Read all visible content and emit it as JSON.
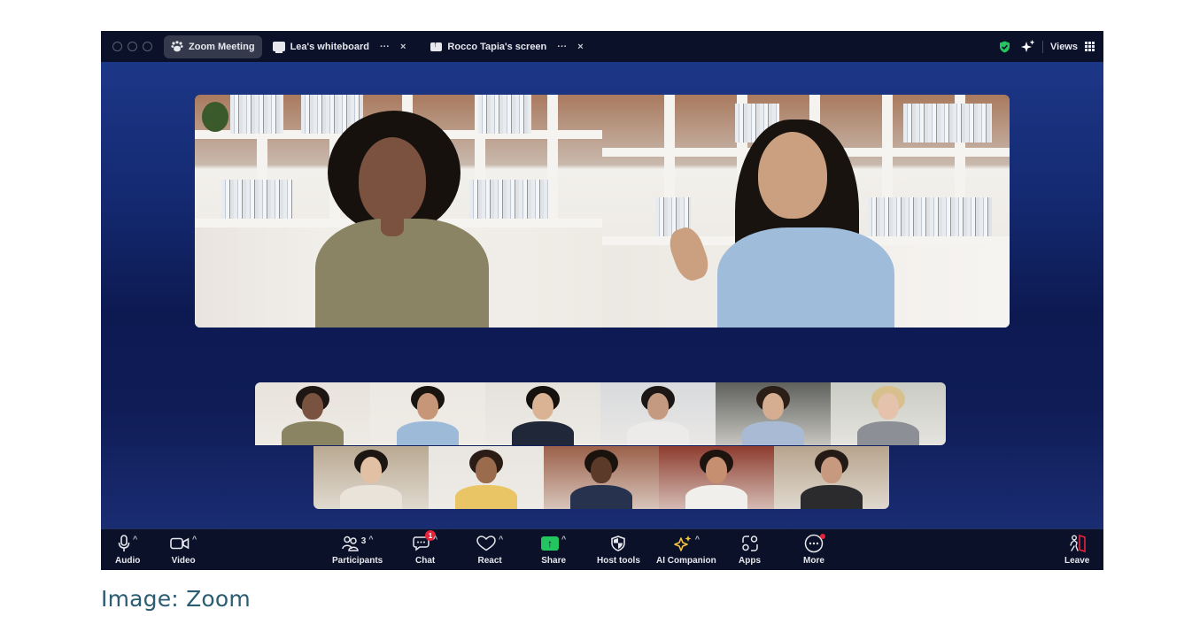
{
  "window": {
    "titlebar": {
      "traffic_lights": [
        "close",
        "minimize",
        "zoom"
      ],
      "tabs": [
        {
          "label": "Zoom Meeting",
          "icon": "paw-icon",
          "active": true
        },
        {
          "label": "Lea's whiteboard",
          "icon": "whiteboard-icon",
          "more": "···",
          "close": "×"
        },
        {
          "label": "Rocco Tapia's screen",
          "icon": "screen-share-icon",
          "more": "···",
          "close": "×"
        }
      ],
      "right": {
        "security_icon": "shield-check-icon",
        "ai_icon": "sparkle-icon",
        "views_label": "Views",
        "views_icon": "grid-icon"
      }
    },
    "speakers": [
      {
        "name": "speaker-left",
        "description": "woman with curly hair, olive top, bookshelf background"
      },
      {
        "name": "speaker-right",
        "description": "woman with long dark hair, denim shirt, waving, bookshelf background"
      }
    ],
    "gallery": {
      "row1": [
        {
          "id": 1,
          "colors": {
            "bg": "#e8e3dc",
            "skin": "#7a5240",
            "hair": "#1e1612",
            "body": "#8b8463"
          }
        },
        {
          "id": 2,
          "colors": {
            "bg": "#ece8e2",
            "skin": "#c79678",
            "hair": "#1a1410",
            "body": "#9dbbd8"
          }
        },
        {
          "id": 3,
          "colors": {
            "bg": "#e5e2dc",
            "skin": "#d9b394",
            "hair": "#15110e",
            "body": "#1f2738"
          }
        },
        {
          "id": 4,
          "colors": {
            "bg": "#d8dadd",
            "skin": "#c49a80",
            "hair": "#1c1714",
            "body": "#ecebea"
          }
        },
        {
          "id": 5,
          "colors": {
            "bg": "#5f615d",
            "skin": "#d5ad90",
            "hair": "#2a1e17",
            "body": "#a9bbd4"
          }
        },
        {
          "id": 6,
          "colors": {
            "bg": "#c9ccc4",
            "skin": "#e4c2ab",
            "hair": "#d8c08e",
            "body": "#8c9096"
          }
        }
      ],
      "row2": [
        {
          "id": 7,
          "colors": {
            "bg": "#b9a992",
            "skin": "#e2c0a4",
            "hair": "#1c1613",
            "body": "#e9e3da"
          }
        },
        {
          "id": 8,
          "colors": {
            "bg": "#e9e6e1",
            "skin": "#9b6b4e",
            "hair": "#2b1d15",
            "body": "#eac566"
          }
        },
        {
          "id": 9,
          "colors": {
            "bg": "#9b6049",
            "skin": "#5c3a2a",
            "hair": "#1a120d",
            "body": "#26324e"
          }
        },
        {
          "id": 10,
          "colors": {
            "bg": "#8e3d2f",
            "skin": "#c58f70",
            "hair": "#1d1410",
            "body": "#f1efec"
          }
        },
        {
          "id": 11,
          "colors": {
            "bg": "#b7a48d",
            "skin": "#c79a80",
            "hair": "#231a15",
            "body": "#2b2b2e"
          }
        }
      ]
    },
    "toolbar": {
      "left": [
        {
          "label": "Audio",
          "icon": "microphone-icon",
          "caret": "^"
        },
        {
          "label": "Video",
          "icon": "video-camera-icon",
          "caret": "^"
        }
      ],
      "center": [
        {
          "label": "Participants",
          "icon": "participants-icon",
          "count": "3",
          "caret": "^"
        },
        {
          "label": "Chat",
          "icon": "chat-icon",
          "badge": "1",
          "caret": "^"
        },
        {
          "label": "React",
          "icon": "heart-icon",
          "caret": "^"
        },
        {
          "label": "Share",
          "icon": "share-arrow-icon",
          "caret": "^"
        },
        {
          "label": "Host tools",
          "icon": "shield-icon"
        },
        {
          "label": "AI Companion",
          "icon": "sparkle-icon",
          "caret": "^"
        },
        {
          "label": "Apps",
          "icon": "apps-icon"
        },
        {
          "label": "More",
          "icon": "more-icon",
          "dot_badge": true
        }
      ],
      "right": [
        {
          "label": "Leave",
          "icon": "leave-door-icon"
        }
      ]
    }
  },
  "caption": "Image: Zoom",
  "colors": {
    "titlebar_bg": "#0b1128",
    "active_tab_bg": "#343a4c",
    "meeting_bg_top": "#1f3a8c",
    "meeting_bg_mid": "#0d1a52",
    "share_green": "#22c55e",
    "shield_green": "#22c55e",
    "badge_red": "#e5243b",
    "ai_gold": "#f4c542",
    "leave_red": "#e5243b",
    "caption_color": "#2b5c72"
  }
}
